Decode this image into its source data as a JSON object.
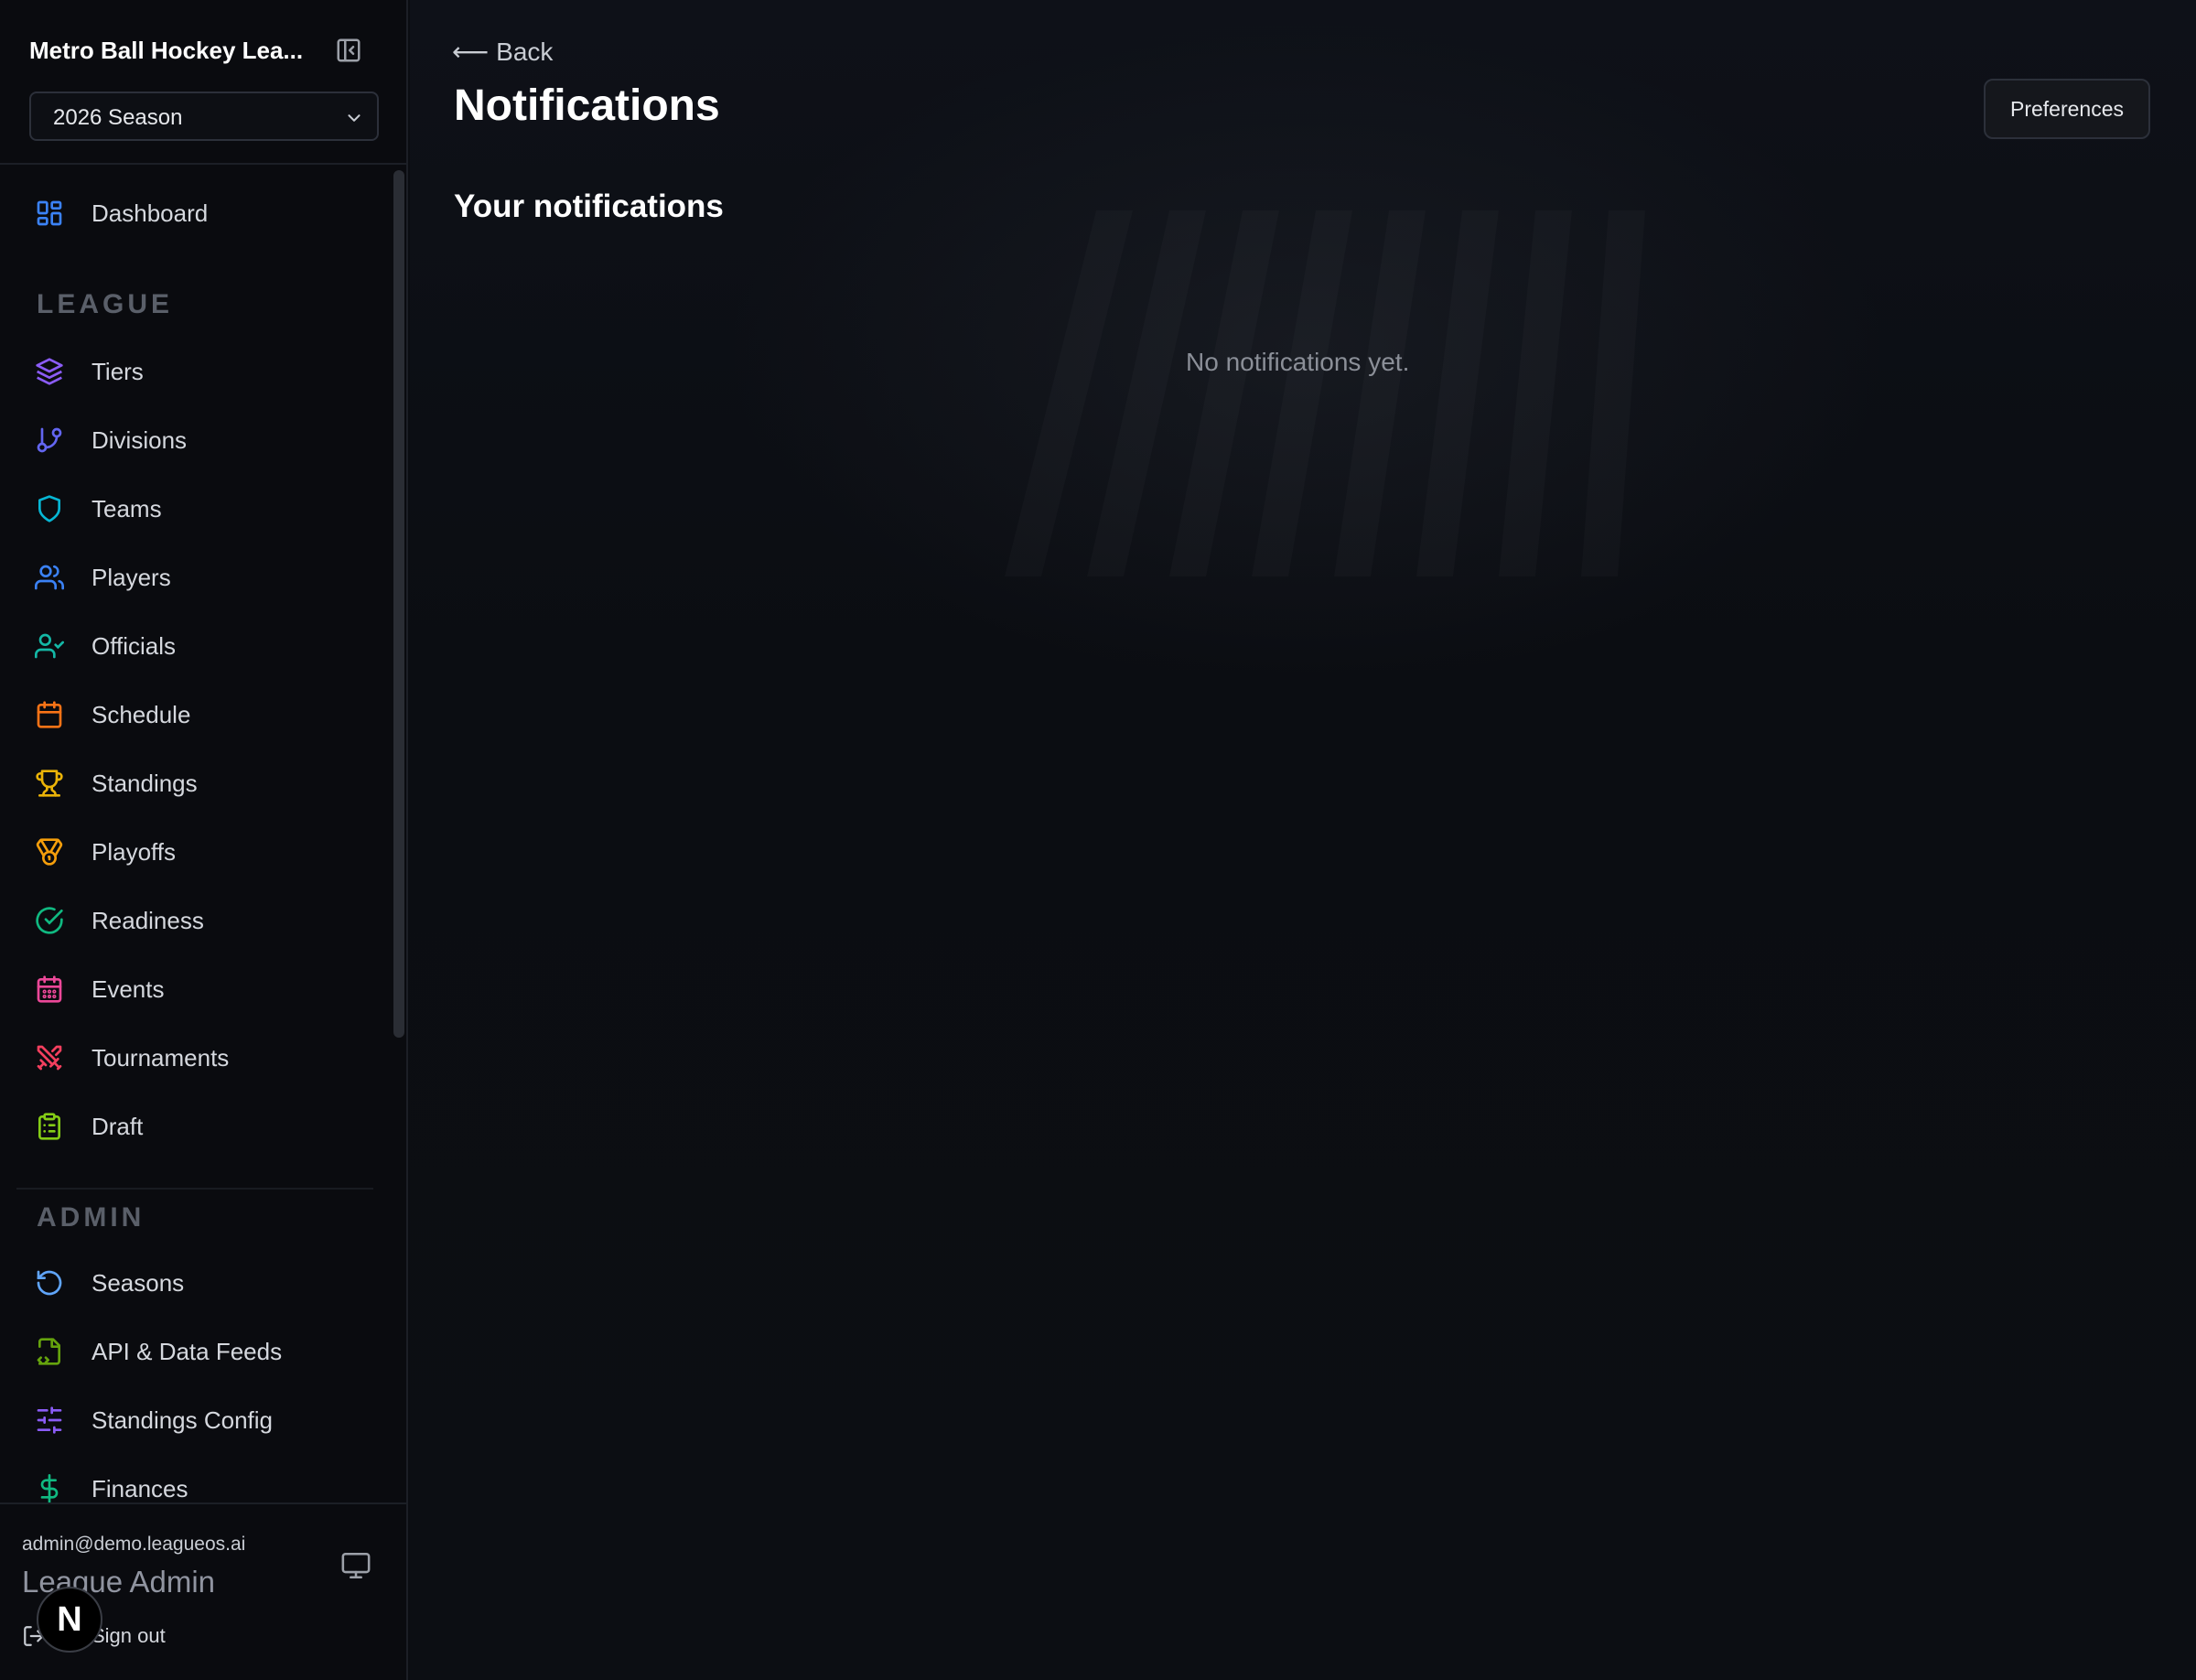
{
  "sidebar": {
    "league_name": "Metro Ball Hockey Lea...",
    "season_selected": "2026 Season",
    "dashboard": {
      "label": "Dashboard",
      "icon": "dashboard-grid-icon",
      "color": "#3b82f6"
    },
    "league_section": {
      "title": "LEAGUE",
      "items": [
        {
          "label": "Tiers",
          "icon": "layers-icon",
          "color": "#8b5cf6"
        },
        {
          "label": "Divisions",
          "icon": "git-branch-icon",
          "color": "#6366f1"
        },
        {
          "label": "Teams",
          "icon": "shield-icon",
          "color": "#06b6d4"
        },
        {
          "label": "Players",
          "icon": "users-icon",
          "color": "#3b82f6"
        },
        {
          "label": "Officials",
          "icon": "user-check-icon",
          "color": "#14b8a6"
        },
        {
          "label": "Schedule",
          "icon": "calendar-icon",
          "color": "#f97316"
        },
        {
          "label": "Standings",
          "icon": "trophy-icon",
          "color": "#eab308"
        },
        {
          "label": "Playoffs",
          "icon": "medal-icon",
          "color": "#f59e0b"
        },
        {
          "label": "Readiness",
          "icon": "check-circle-icon",
          "color": "#10b981"
        },
        {
          "label": "Events",
          "icon": "calendar-days-icon",
          "color": "#ec4899"
        },
        {
          "label": "Tournaments",
          "icon": "swords-icon",
          "color": "#f43f5e"
        },
        {
          "label": "Draft",
          "icon": "clipboard-list-icon",
          "color": "#84cc16"
        }
      ]
    },
    "admin_section": {
      "title": "ADMIN",
      "items": [
        {
          "label": "Seasons",
          "icon": "rotate-ccw-icon",
          "color": "#60a5fa"
        },
        {
          "label": "API & Data Feeds",
          "icon": "file-code-icon",
          "color": "#65a30d"
        },
        {
          "label": "Standings Config",
          "icon": "sliders-icon",
          "color": "#8b5cf6"
        },
        {
          "label": "Finances",
          "icon": "dollar-sign-icon",
          "color": "#10b981"
        }
      ]
    },
    "footer": {
      "email": "admin@demo.leagueos.ai",
      "role": "League Admin",
      "sign_out": "Sign out",
      "badge_letter": "N"
    }
  },
  "main": {
    "back_label": "Back",
    "back_arrow": "⟵",
    "title": "Notifications",
    "preferences_label": "Preferences",
    "section_title": "Your notifications",
    "empty_message": "No notifications yet."
  }
}
